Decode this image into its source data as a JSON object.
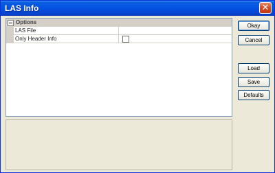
{
  "window": {
    "title": "LAS Info"
  },
  "property_grid": {
    "category": "Options",
    "properties": [
      {
        "name": "LAS File",
        "value": ""
      },
      {
        "name": "Only Header Info",
        "checked": false
      }
    ]
  },
  "buttons": {
    "okay": "Okay",
    "cancel": "Cancel",
    "load": "Load",
    "save": "Save",
    "defaults": "Defaults"
  }
}
